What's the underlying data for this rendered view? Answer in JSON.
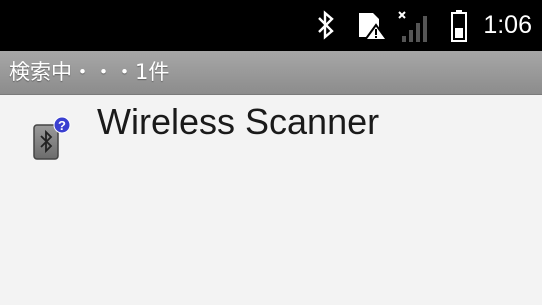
{
  "status_bar": {
    "time": "1:06",
    "icons": [
      "bluetooth-icon",
      "sim-warning-icon",
      "no-signal-icon",
      "battery-icon"
    ]
  },
  "title_bar": {
    "title": "検索中・・・1件"
  },
  "device_list": {
    "items": [
      {
        "name": "Wireless Scanner",
        "icon": "bluetooth-unknown-device-icon"
      }
    ]
  },
  "colors": {
    "status_bar_bg": "#000000",
    "title_bar_bg": "#9a9a9a",
    "content_bg": "#f3f3f3",
    "question_badge": "#3a3fd0"
  }
}
